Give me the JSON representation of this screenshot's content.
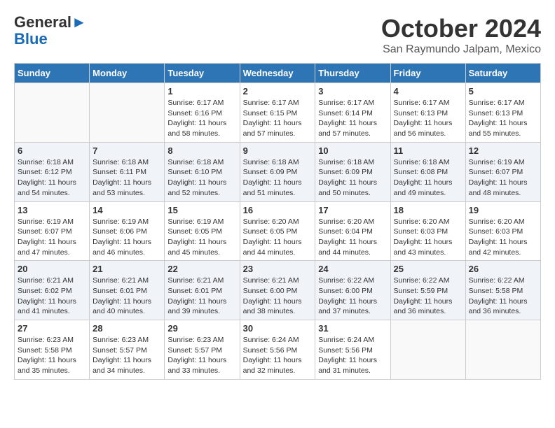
{
  "header": {
    "logo_general": "General",
    "logo_blue": "Blue",
    "month": "October 2024",
    "location": "San Raymundo Jalpam, Mexico"
  },
  "weekdays": [
    "Sunday",
    "Monday",
    "Tuesday",
    "Wednesday",
    "Thursday",
    "Friday",
    "Saturday"
  ],
  "weeks": [
    [
      {
        "day": "",
        "content": ""
      },
      {
        "day": "",
        "content": ""
      },
      {
        "day": "1",
        "content": "Sunrise: 6:17 AM\nSunset: 6:16 PM\nDaylight: 11 hours and 58 minutes."
      },
      {
        "day": "2",
        "content": "Sunrise: 6:17 AM\nSunset: 6:15 PM\nDaylight: 11 hours and 57 minutes."
      },
      {
        "day": "3",
        "content": "Sunrise: 6:17 AM\nSunset: 6:14 PM\nDaylight: 11 hours and 57 minutes."
      },
      {
        "day": "4",
        "content": "Sunrise: 6:17 AM\nSunset: 6:13 PM\nDaylight: 11 hours and 56 minutes."
      },
      {
        "day": "5",
        "content": "Sunrise: 6:17 AM\nSunset: 6:13 PM\nDaylight: 11 hours and 55 minutes."
      }
    ],
    [
      {
        "day": "6",
        "content": "Sunrise: 6:18 AM\nSunset: 6:12 PM\nDaylight: 11 hours and 54 minutes."
      },
      {
        "day": "7",
        "content": "Sunrise: 6:18 AM\nSunset: 6:11 PM\nDaylight: 11 hours and 53 minutes."
      },
      {
        "day": "8",
        "content": "Sunrise: 6:18 AM\nSunset: 6:10 PM\nDaylight: 11 hours and 52 minutes."
      },
      {
        "day": "9",
        "content": "Sunrise: 6:18 AM\nSunset: 6:09 PM\nDaylight: 11 hours and 51 minutes."
      },
      {
        "day": "10",
        "content": "Sunrise: 6:18 AM\nSunset: 6:09 PM\nDaylight: 11 hours and 50 minutes."
      },
      {
        "day": "11",
        "content": "Sunrise: 6:18 AM\nSunset: 6:08 PM\nDaylight: 11 hours and 49 minutes."
      },
      {
        "day": "12",
        "content": "Sunrise: 6:19 AM\nSunset: 6:07 PM\nDaylight: 11 hours and 48 minutes."
      }
    ],
    [
      {
        "day": "13",
        "content": "Sunrise: 6:19 AM\nSunset: 6:07 PM\nDaylight: 11 hours and 47 minutes."
      },
      {
        "day": "14",
        "content": "Sunrise: 6:19 AM\nSunset: 6:06 PM\nDaylight: 11 hours and 46 minutes."
      },
      {
        "day": "15",
        "content": "Sunrise: 6:19 AM\nSunset: 6:05 PM\nDaylight: 11 hours and 45 minutes."
      },
      {
        "day": "16",
        "content": "Sunrise: 6:20 AM\nSunset: 6:05 PM\nDaylight: 11 hours and 44 minutes."
      },
      {
        "day": "17",
        "content": "Sunrise: 6:20 AM\nSunset: 6:04 PM\nDaylight: 11 hours and 44 minutes."
      },
      {
        "day": "18",
        "content": "Sunrise: 6:20 AM\nSunset: 6:03 PM\nDaylight: 11 hours and 43 minutes."
      },
      {
        "day": "19",
        "content": "Sunrise: 6:20 AM\nSunset: 6:03 PM\nDaylight: 11 hours and 42 minutes."
      }
    ],
    [
      {
        "day": "20",
        "content": "Sunrise: 6:21 AM\nSunset: 6:02 PM\nDaylight: 11 hours and 41 minutes."
      },
      {
        "day": "21",
        "content": "Sunrise: 6:21 AM\nSunset: 6:01 PM\nDaylight: 11 hours and 40 minutes."
      },
      {
        "day": "22",
        "content": "Sunrise: 6:21 AM\nSunset: 6:01 PM\nDaylight: 11 hours and 39 minutes."
      },
      {
        "day": "23",
        "content": "Sunrise: 6:21 AM\nSunset: 6:00 PM\nDaylight: 11 hours and 38 minutes."
      },
      {
        "day": "24",
        "content": "Sunrise: 6:22 AM\nSunset: 6:00 PM\nDaylight: 11 hours and 37 minutes."
      },
      {
        "day": "25",
        "content": "Sunrise: 6:22 AM\nSunset: 5:59 PM\nDaylight: 11 hours and 36 minutes."
      },
      {
        "day": "26",
        "content": "Sunrise: 6:22 AM\nSunset: 5:58 PM\nDaylight: 11 hours and 36 minutes."
      }
    ],
    [
      {
        "day": "27",
        "content": "Sunrise: 6:23 AM\nSunset: 5:58 PM\nDaylight: 11 hours and 35 minutes."
      },
      {
        "day": "28",
        "content": "Sunrise: 6:23 AM\nSunset: 5:57 PM\nDaylight: 11 hours and 34 minutes."
      },
      {
        "day": "29",
        "content": "Sunrise: 6:23 AM\nSunset: 5:57 PM\nDaylight: 11 hours and 33 minutes."
      },
      {
        "day": "30",
        "content": "Sunrise: 6:24 AM\nSunset: 5:56 PM\nDaylight: 11 hours and 32 minutes."
      },
      {
        "day": "31",
        "content": "Sunrise: 6:24 AM\nSunset: 5:56 PM\nDaylight: 11 hours and 31 minutes."
      },
      {
        "day": "",
        "content": ""
      },
      {
        "day": "",
        "content": ""
      }
    ]
  ]
}
